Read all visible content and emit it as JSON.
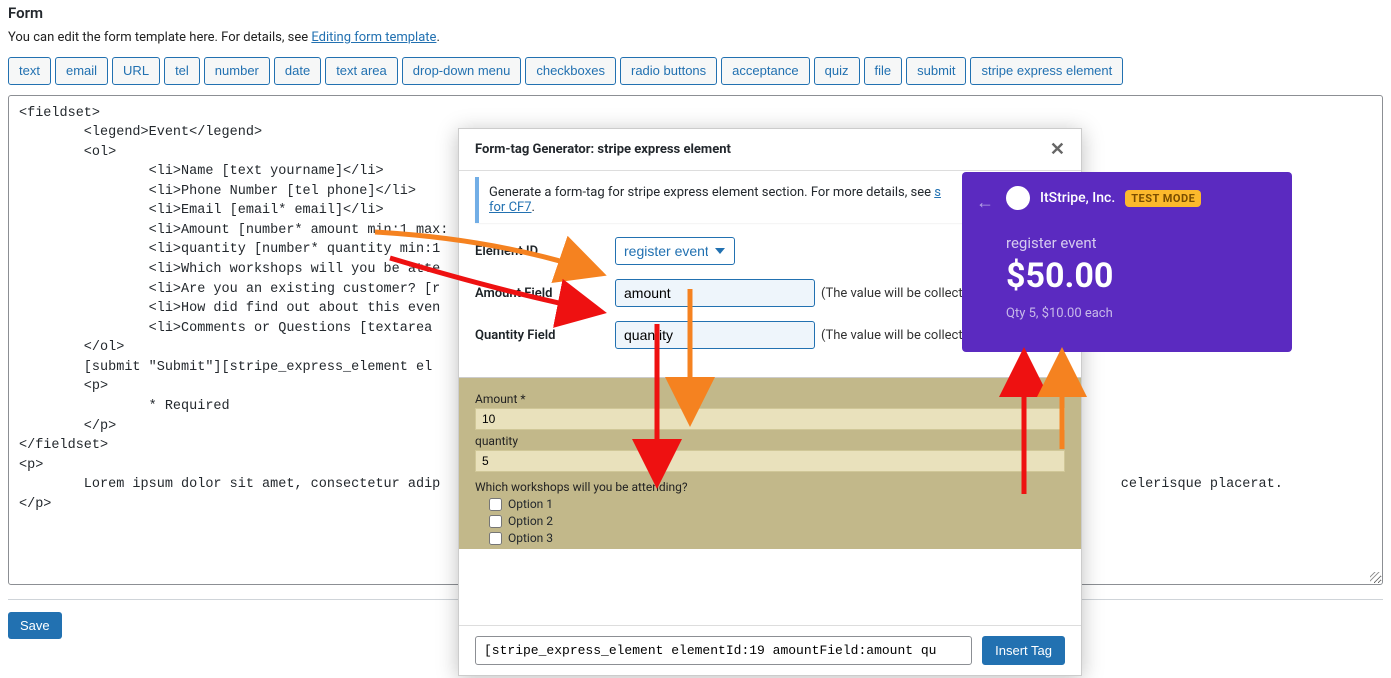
{
  "heading": "Form",
  "desc_prefix": "You can edit the form template here. For details, see ",
  "desc_link": "Editing form template",
  "desc_suffix": ".",
  "tag_buttons": [
    "text",
    "email",
    "URL",
    "tel",
    "number",
    "date",
    "text area",
    "drop-down menu",
    "checkboxes",
    "radio buttons",
    "acceptance",
    "quiz",
    "file",
    "submit",
    "stripe express element"
  ],
  "code": "<fieldset>\n        <legend>Event</legend>\n        <ol>\n                <li>Name [text yourname]</li>\n                <li>Phone Number [tel phone]</li>\n                <li>Email [email* email]</li>\n                <li>Amount [number* amount min:1 max:\n                <li>quantity [number* quantity min:1\n                <li>Which workshops will you be atte\n                <li>Are you an existing customer? [r\n                <li>How did find out about this even\n                <li>Comments or Questions [textarea \n        </ol>\n        [submit \"Submit\"][stripe_express_element el\n        <p>\n                * Required\n        </p>\n</fieldset>\n<p>\n        Lorem ipsum dolor sit amet, consectetur adip                                                                                    celerisque placerat.\n</p>",
  "save_label": "Save",
  "modal": {
    "title": "Form-tag Generator: stripe express element",
    "info_before": "Generate a form-tag for stripe express element section. For more details, see ",
    "info_link_visible": "s",
    "info_link2": "for CF7",
    "info_period": ".",
    "labels": {
      "element_id": "Element ID",
      "amount_field": "Amount Field",
      "quantity_field": "Quantity Field"
    },
    "element_id_value": "register event",
    "amount_value": "amount",
    "quantity_value": "quantity",
    "hint": "(The value will be collecte",
    "preview": {
      "amount_label": "Amount *",
      "amount_value": "10",
      "quantity_label": "quantity",
      "quantity_value": "5",
      "workshops_label": "Which workshops will you be attending?",
      "opts": [
        "Option 1",
        "Option 2",
        "Option 3"
      ]
    },
    "tag_output": "[stripe_express_element elementId:19 amountField:amount qu",
    "insert_label": "Insert Tag"
  },
  "stripe": {
    "company": "ItStripe, Inc.",
    "badge": "TEST MODE",
    "item": "register event",
    "amount": "$50.00",
    "qty_line": "Qty 5, $10.00 each"
  }
}
